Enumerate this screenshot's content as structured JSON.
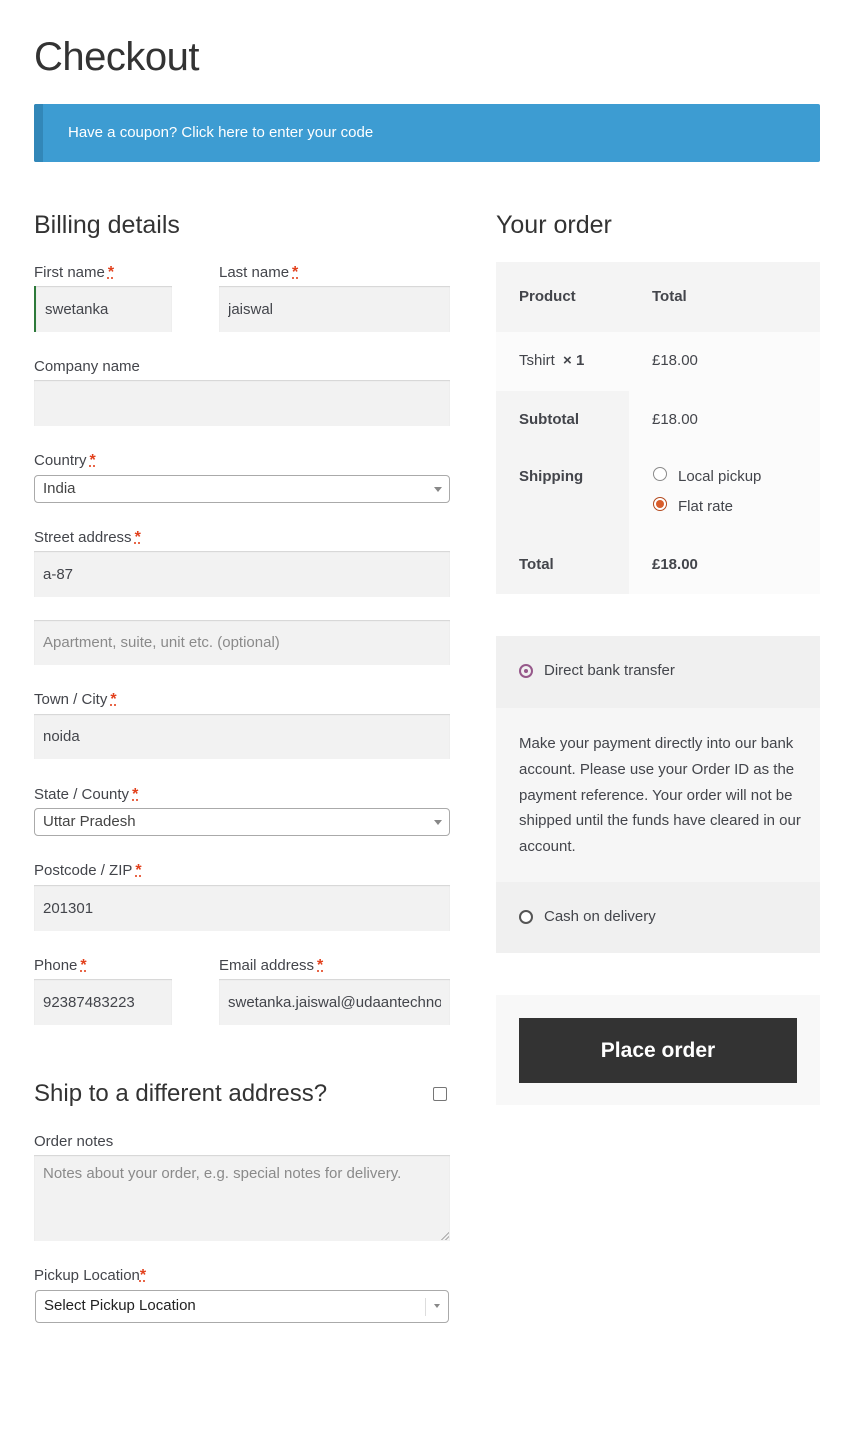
{
  "page": {
    "title": "Checkout"
  },
  "coupon": {
    "text": "Have a coupon? Click here to enter your code"
  },
  "billing": {
    "heading": "Billing details",
    "required_mark": "*",
    "first_name": {
      "label": "First name",
      "value": "swetanka"
    },
    "last_name": {
      "label": "Last name",
      "value": "jaiswal"
    },
    "company": {
      "label": "Company name",
      "value": ""
    },
    "country": {
      "label": "Country",
      "value": "India"
    },
    "street": {
      "label": "Street address",
      "value": "a-87",
      "placeholder2": "Apartment, suite, unit etc. (optional)"
    },
    "city": {
      "label": "Town / City",
      "value": "noida"
    },
    "state": {
      "label": "State / County",
      "value": "Uttar Pradesh"
    },
    "postcode": {
      "label": "Postcode / ZIP",
      "value": "201301"
    },
    "phone": {
      "label": "Phone",
      "value": "92387483223"
    },
    "email": {
      "label": "Email address",
      "value": "swetanka.jaiswal@udaantechnologies.com"
    }
  },
  "shipping": {
    "heading": "Ship to a different address?"
  },
  "notes": {
    "label": "Order notes",
    "placeholder": "Notes about your order, e.g. special notes for delivery."
  },
  "pickup": {
    "label": "Pickup Location",
    "value": "Select Pickup Location"
  },
  "order": {
    "heading": "Your order",
    "col_product": "Product",
    "col_total": "Total",
    "item_name": "Tshirt",
    "item_qty": "× 1",
    "item_total": "£18.00",
    "subtotal_label": "Subtotal",
    "subtotal_value": "£18.00",
    "shipping_label": "Shipping",
    "shipping_options": [
      "Local pickup",
      "Flat rate"
    ],
    "total_label": "Total",
    "total_value": "£18.00"
  },
  "payment": {
    "method1": "Direct bank transfer",
    "method1_desc": "Make your payment directly into our bank account. Please use your Order ID as the payment reference. Your order will not be shipped until the funds have cleared in our account.",
    "method2": "Cash on delivery"
  },
  "place_order": "Place order"
}
